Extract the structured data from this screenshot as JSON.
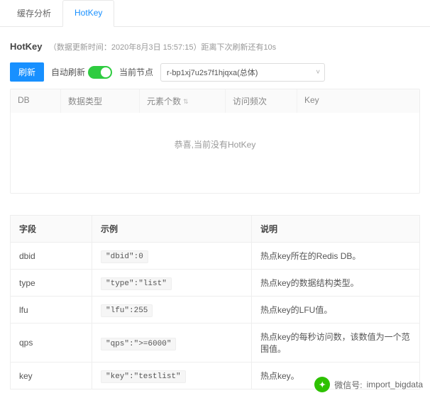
{
  "tabs": {
    "t0": "缓存分析",
    "t1": "HotKey"
  },
  "header": {
    "title": "HotKey",
    "meta": "（数据更新时间：2020年8月3日 15:57:15）距离下次刷新还有10s"
  },
  "toolbar": {
    "refresh": "刷新",
    "autoRefresh": "自动刷新",
    "nodeLabel": "当前节点",
    "nodeValue": "r-bp1xj7u2s7f1hjqxa(总体)"
  },
  "grid": {
    "cols": {
      "db": "DB",
      "type": "数据类型",
      "count": "元素个数",
      "freq": "访问频次",
      "key": "Key"
    },
    "empty": "恭喜,当前没有HotKey"
  },
  "doc": {
    "head": {
      "field": "字段",
      "example": "示例",
      "desc": "说明"
    },
    "rows": [
      {
        "field": "dbid",
        "example": "\"dbid\":0",
        "desc": "热点key所在的Redis DB。"
      },
      {
        "field": "type",
        "example": "\"type\":\"list\"",
        "desc": "热点key的数据结构类型。"
      },
      {
        "field": "lfu",
        "example": "\"lfu\":255",
        "desc": "热点key的LFU值。"
      },
      {
        "field": "qps",
        "example": "\"qps\":\">=6000\"",
        "desc": "热点key的每秒访问数，该数值为一个范围值。"
      },
      {
        "field": "key",
        "example": "\"key\":\"testlist\"",
        "desc": "热点key。"
      }
    ]
  },
  "footer": {
    "label": "微信号:",
    "value": "import_bigdata"
  }
}
